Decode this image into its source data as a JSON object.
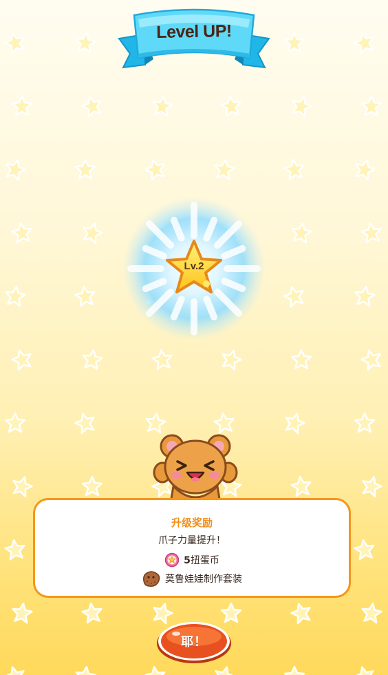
{
  "banner": {
    "title": "Level UP!"
  },
  "level": {
    "label": "Lv.2"
  },
  "reward": {
    "title": "升级奖励",
    "description": "爪子力量提升！",
    "coin": {
      "count": "5",
      "label": "扭蛋币",
      "icon": "gacha-coin-icon"
    },
    "kit": {
      "label": "莫鲁娃娃制作套装",
      "icon": "plush-kit-icon"
    }
  },
  "confirm_button": {
    "label": "耶！"
  },
  "colors": {
    "banner_blue": "#3cc9f0",
    "accent_orange": "#f5961c",
    "button_red": "#e8501f",
    "star_yellow": "#ffd83a"
  }
}
